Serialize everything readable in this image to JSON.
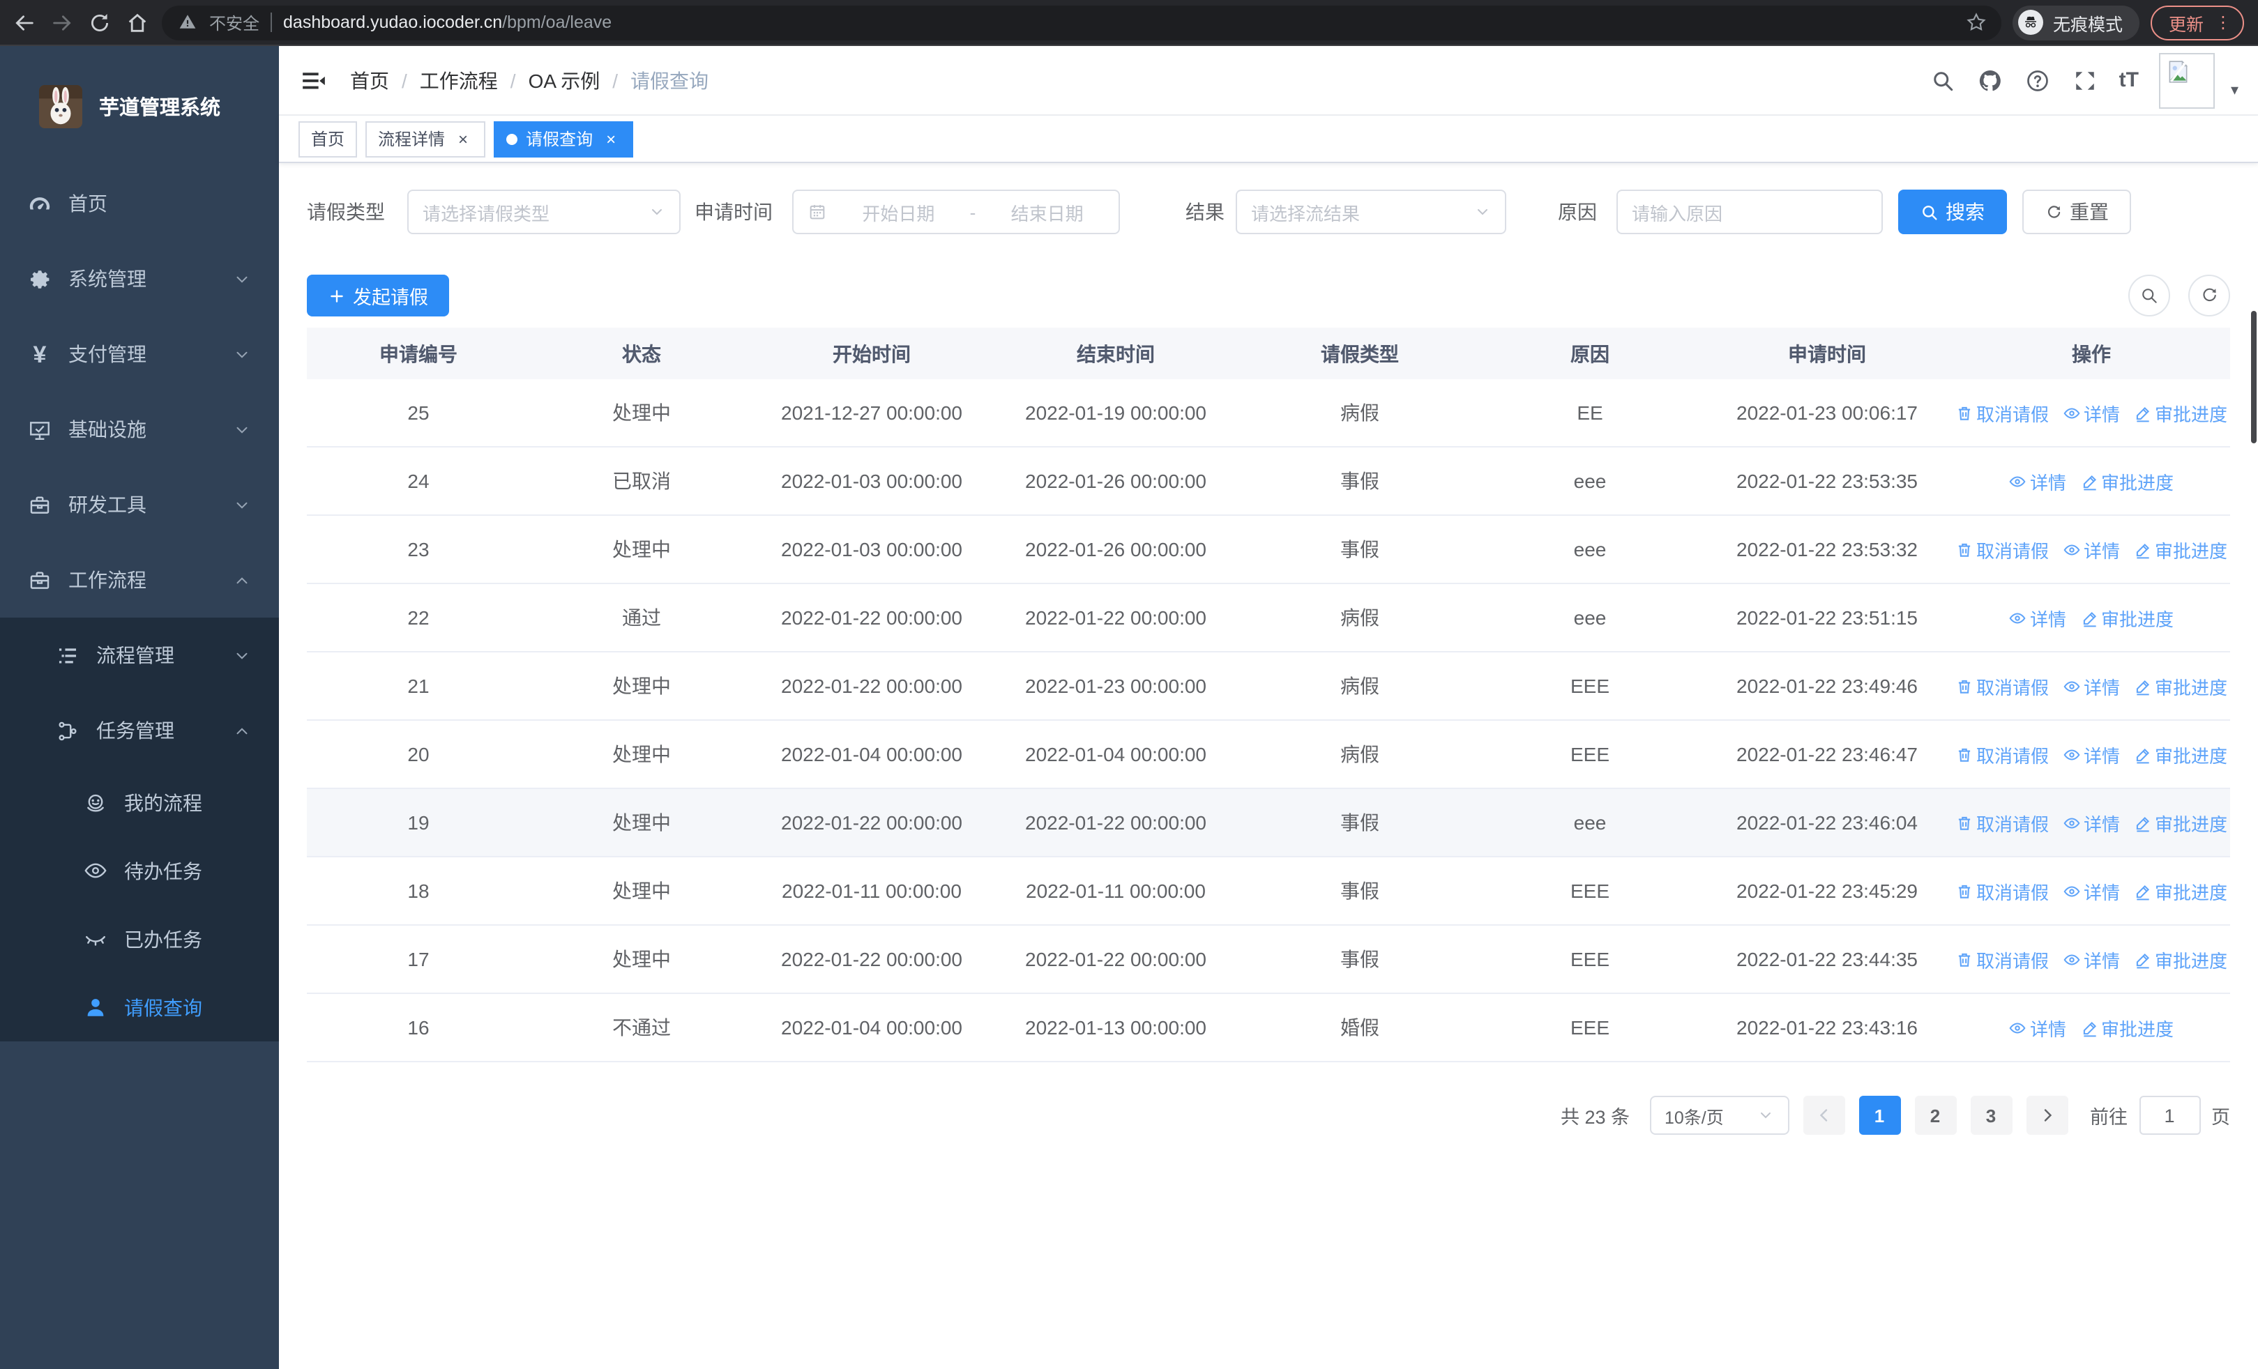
{
  "colors": {
    "primary": "#2d8cf6",
    "link": "#5ea3f9",
    "sidebar_bg": "#304156",
    "sidebar_sub_bg": "#1f2d3d",
    "sidebar_active": "#409eff"
  },
  "browser": {
    "security_label": "不安全",
    "url_host": "dashboard.yudao.iocoder.cn",
    "url_path": "/bpm/oa/leave",
    "incognito_label": "无痕模式",
    "update_label": "更新",
    "menu_dots": "⋮"
  },
  "sidebar": {
    "app_title": "芋道管理系统",
    "items": [
      {
        "label": "首页",
        "icon": "dashboard-icon",
        "level": 1
      },
      {
        "label": "系统管理",
        "icon": "gear-icon",
        "level": 1,
        "chevron": "down"
      },
      {
        "label": "支付管理",
        "icon": "yen-icon",
        "level": 1,
        "chevron": "down"
      },
      {
        "label": "基础设施",
        "icon": "monitor-icon",
        "level": 1,
        "chevron": "down"
      },
      {
        "label": "研发工具",
        "icon": "toolbox-icon",
        "level": 1,
        "chevron": "down"
      },
      {
        "label": "工作流程",
        "icon": "workflow-icon",
        "level": 1,
        "chevron": "up"
      },
      {
        "label": "流程管理",
        "icon": "list-icon",
        "level": 2,
        "chevron": "down",
        "sub": true
      },
      {
        "label": "任务管理",
        "icon": "tree-icon",
        "level": 2,
        "chevron": "up",
        "sub": true
      },
      {
        "label": "我的流程",
        "icon": "face-icon",
        "level": 3,
        "sub": true
      },
      {
        "label": "待办任务",
        "icon": "eye-open-icon",
        "level": 3,
        "sub": true
      },
      {
        "label": "已办任务",
        "icon": "eye-closed-icon",
        "level": 3,
        "sub": true
      },
      {
        "label": "请假查询",
        "icon": "user-icon",
        "level": 3,
        "sub": true,
        "active": true
      }
    ]
  },
  "breadcrumb": [
    "首页",
    "工作流程",
    "OA 示例",
    "请假查询"
  ],
  "tabs": [
    {
      "label": "首页",
      "closable": false,
      "active": false
    },
    {
      "label": "流程详情",
      "closable": true,
      "active": false
    },
    {
      "label": "请假查询",
      "closable": true,
      "active": true
    }
  ],
  "filters": {
    "leave_type_label": "请假类型",
    "leave_type_placeholder": "请选择请假类型",
    "apply_time_label": "申请时间",
    "date_start_placeholder": "开始日期",
    "date_separator": "-",
    "date_end_placeholder": "结束日期",
    "result_label": "结果",
    "result_placeholder": "请选择流结果",
    "reason_label": "原因",
    "reason_placeholder": "请输入原因",
    "search_label": "搜索",
    "reset_label": "重置"
  },
  "toolbar": {
    "create_label": "发起请假"
  },
  "table": {
    "columns": [
      "申请编号",
      "状态",
      "开始时间",
      "结束时间",
      "请假类型",
      "原因",
      "申请时间",
      "操作"
    ],
    "action_labels": {
      "cancel": "取消请假",
      "detail": "详情",
      "progress": "审批进度"
    },
    "rows": [
      {
        "id": "25",
        "status": "处理中",
        "start": "2021-12-27 00:00:00",
        "end": "2022-01-19 00:00:00",
        "type": "病假",
        "reason": "EE",
        "applied": "2022-01-23 00:06:17",
        "cancel": true,
        "highlight": false
      },
      {
        "id": "24",
        "status": "已取消",
        "start": "2022-01-03 00:00:00",
        "end": "2022-01-26 00:00:00",
        "type": "事假",
        "reason": "eee",
        "applied": "2022-01-22 23:53:35",
        "cancel": false,
        "highlight": false
      },
      {
        "id": "23",
        "status": "处理中",
        "start": "2022-01-03 00:00:00",
        "end": "2022-01-26 00:00:00",
        "type": "事假",
        "reason": "eee",
        "applied": "2022-01-22 23:53:32",
        "cancel": true,
        "highlight": false
      },
      {
        "id": "22",
        "status": "通过",
        "start": "2022-01-22 00:00:00",
        "end": "2022-01-22 00:00:00",
        "type": "病假",
        "reason": "eee",
        "applied": "2022-01-22 23:51:15",
        "cancel": false,
        "highlight": false
      },
      {
        "id": "21",
        "status": "处理中",
        "start": "2022-01-22 00:00:00",
        "end": "2022-01-23 00:00:00",
        "type": "病假",
        "reason": "EEE",
        "applied": "2022-01-22 23:49:46",
        "cancel": true,
        "highlight": false
      },
      {
        "id": "20",
        "status": "处理中",
        "start": "2022-01-04 00:00:00",
        "end": "2022-01-04 00:00:00",
        "type": "病假",
        "reason": "EEE",
        "applied": "2022-01-22 23:46:47",
        "cancel": true,
        "highlight": false
      },
      {
        "id": "19",
        "status": "处理中",
        "start": "2022-01-22 00:00:00",
        "end": "2022-01-22 00:00:00",
        "type": "事假",
        "reason": "eee",
        "applied": "2022-01-22 23:46:04",
        "cancel": true,
        "highlight": true
      },
      {
        "id": "18",
        "status": "处理中",
        "start": "2022-01-11 00:00:00",
        "end": "2022-01-11 00:00:00",
        "type": "事假",
        "reason": "EEE",
        "applied": "2022-01-22 23:45:29",
        "cancel": true,
        "highlight": false
      },
      {
        "id": "17",
        "status": "处理中",
        "start": "2022-01-22 00:00:00",
        "end": "2022-01-22 00:00:00",
        "type": "事假",
        "reason": "EEE",
        "applied": "2022-01-22 23:44:35",
        "cancel": true,
        "highlight": false
      },
      {
        "id": "16",
        "status": "不通过",
        "start": "2022-01-04 00:00:00",
        "end": "2022-01-13 00:00:00",
        "type": "婚假",
        "reason": "EEE",
        "applied": "2022-01-22 23:43:16",
        "cancel": false,
        "highlight": false
      }
    ]
  },
  "pagination": {
    "total_label": "共 23 条",
    "page_size": "10条/页",
    "pages": [
      "1",
      "2",
      "3"
    ],
    "active_page": "1",
    "goto_label": "前往",
    "goto_value": "1",
    "goto_suffix": "页"
  }
}
